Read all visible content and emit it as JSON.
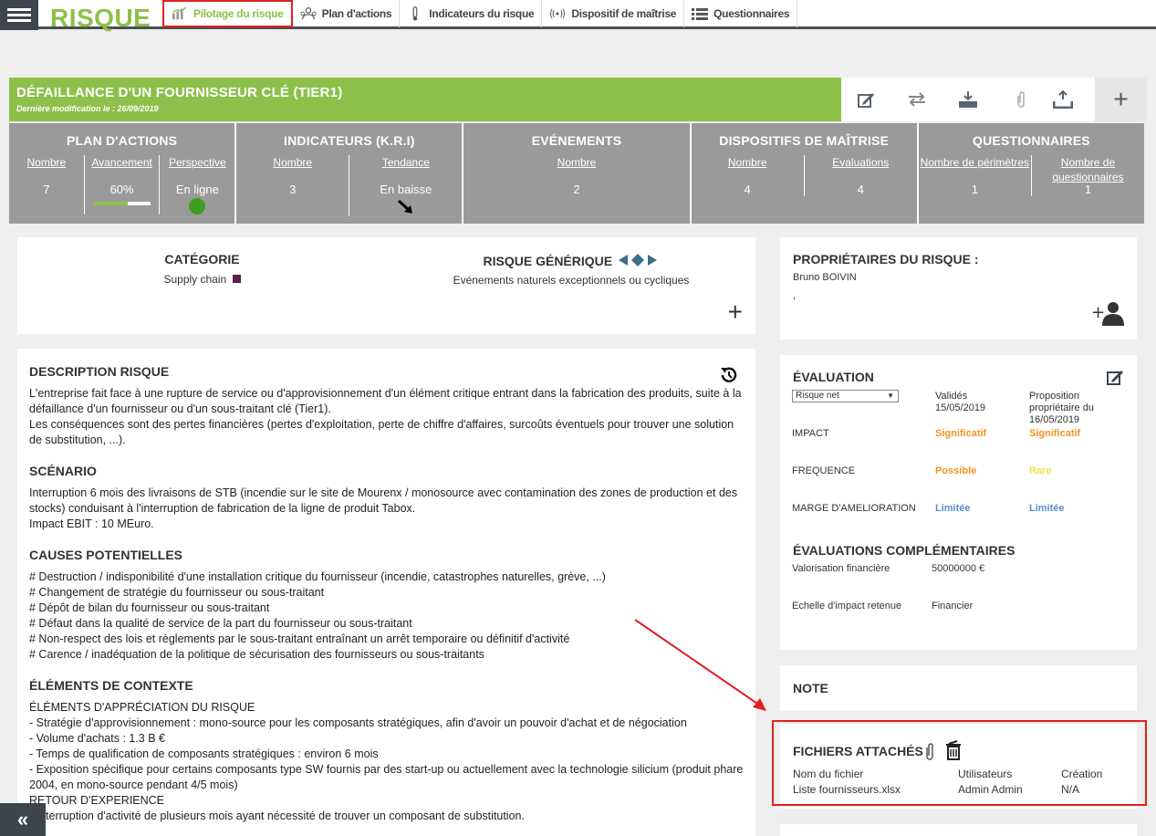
{
  "app": {
    "brand": "RISQUE"
  },
  "nav": {
    "tabs": [
      {
        "label": "Pilotage du risque",
        "icon": "bar-chart-icon"
      },
      {
        "label": "Plan d'actions",
        "icon": "people-plan-icon"
      },
      {
        "label": "Indicateurs du risque",
        "icon": "thermometer-icon"
      },
      {
        "label": "Dispositif de maîtrise",
        "icon": "broadcast-icon"
      },
      {
        "label": "Questionnaires",
        "icon": "list-icon"
      }
    ]
  },
  "header": {
    "title": "DÉFAILLANCE D'UN FOURNISSEUR CLÉ (TIER1)",
    "last_modified": "Dernière modification le : 26/09/2019"
  },
  "stats": {
    "plan": {
      "title": "PLAN D'ACTIONS",
      "nombre_lbl": "Nombre",
      "nombre": "7",
      "avancement_lbl": "Avancement",
      "avancement": "60%",
      "progress": 0.6,
      "perspective_lbl": "Perspective",
      "perspective": "En ligne",
      "perspective_color": "#3f9c1f"
    },
    "kri": {
      "title": "INDICATEURS (K.R.I)",
      "nombre_lbl": "Nombre",
      "nombre": "3",
      "tendance_lbl": "Tendance",
      "tendance": "En baisse"
    },
    "events": {
      "title": "EVÉNEMENTS",
      "nombre_lbl": "Nombre",
      "nombre": "2"
    },
    "dispositifs": {
      "title": "DISPOSITIFS DE MAÎTRISE",
      "nombre_lbl": "Nombre",
      "nombre": "4",
      "evaluations_lbl": "Evaluations",
      "evaluations": "4"
    },
    "questionnaires": {
      "title": "QUESTIONNAIRES",
      "perimetres_lbl": "Nombre de périmètres",
      "perimetres": "1",
      "questionnaires_lbl": "Nombre de questionnaires",
      "questionnaires": "1"
    }
  },
  "categorie": {
    "title": "CATÉGORIE",
    "value": "Supply chain",
    "swatch_color": "#5a1f4a"
  },
  "generique": {
    "title": "RISQUE GÉNÉRIQUE",
    "value": "Evénements naturels exceptionnels ou cycliques"
  },
  "proprietaires": {
    "title": "PROPRIÉTAIRES DU RISQUE :",
    "name": "Bruno BOIVIN",
    "extra": ","
  },
  "description": {
    "sections": [
      {
        "title": "DESCRIPTION RISQUE",
        "lines": [
          "L'entreprise fait face à une rupture de service ou d'approvisionnement d'un élément critique entrant dans la fabrication des produits, suite à la défaillance d'un fournisseur ou d'un sous-traitant clé (Tier1).",
          "Les conséquences sont des pertes financières (pertes d'exploitation, perte de chiffre d'affaires, surcoûts éventuels pour trouver une solution de substitution, ...)."
        ]
      },
      {
        "title": "SCÉNARIO",
        "lines": [
          "Interruption 6 mois des livraisons de STB (incendie sur le site de Mourenx / monosource avec contamination des zones de production et des stocks) conduisant à l'interruption de fabrication de la ligne de produit Tabox.",
          "Impact EBIT : 10 MEuro."
        ]
      },
      {
        "title": "CAUSES POTENTIELLES",
        "lines": [
          "# Destruction / indisponibilité d'une installation critique du fournisseur (incendie, catastrophes naturelles, grève, ...)",
          "# Changement de stratégie du fournisseur ou sous-traitant",
          "# Dépôt de bilan du fournisseur ou sous-traitant",
          "# Défaut dans la qualité de service de la part du fournisseur ou sous-traitant",
          "# Non-respect des lois et règlements par le sous-traitant entraînant un arrêt temporaire ou définitif d'activité",
          "# Carence / inadéquation de la politique de sécurisation des fournisseurs ou sous-traitants"
        ]
      },
      {
        "title": "ÉLÉMENTS DE CONTEXTE",
        "lines": [
          "ÉLÉMENTS D'APPRÉCIATION DU RISQUE",
          "- Stratégie d'approvisionnement : mono-source pour les composants stratégiques, afin d'avoir un pouvoir d'achat et de négociation",
          "- Volume d'achats : 1.3 B €",
          "- Temps de qualification de composants stratégiques : environ 6 mois",
          "- Exposition spécifique pour certains composants type SW fournis par des start-up ou actuellement avec la technologie silicium (produit phare 2004, en mono-source pendant 4/5 mois)",
          "RETOUR D'EXPERIENCE",
          "- Interruption d'activité de plusieurs mois ayant nécessité de trouver un composant de substitution."
        ]
      }
    ]
  },
  "evaluation": {
    "title": "ÉVALUATION",
    "select": "Risque net",
    "col1_header": "Validés 15/05/2019",
    "col2_header": "Proposition propriétaire du 16/05/2019",
    "rows": [
      {
        "label": "IMPACT",
        "v1": "Significatif",
        "v1_color": "#f29325",
        "v2": "Significatif",
        "v2_color": "#f29325"
      },
      {
        "label": "FREQUENCE",
        "v1": "Possible",
        "v1_color": "#f29325",
        "v2": "Rare",
        "v2_color": "#f2e24a"
      },
      {
        "label": "MARGE D'AMELIORATION",
        "v1": "Limitée",
        "v1_color": "#5a8fc7",
        "v2": "Limitée",
        "v2_color": "#5a8fc7"
      }
    ],
    "comp_title": "ÉVALUATIONS COMPLÉMENTAIRES",
    "comp": [
      {
        "label": "Valorisation financière",
        "value": "50000000 €"
      },
      {
        "label": "Echelle d'impact retenue",
        "value": "Financier"
      }
    ]
  },
  "note": {
    "title": "NOTE"
  },
  "fichiers": {
    "title": "FICHIERS ATTACHÉS",
    "headers": [
      "Nom du fichier",
      "Utilisateurs",
      "Création"
    ],
    "rows": [
      [
        "Liste fournisseurs.xlsx",
        "Admin Admin",
        "N/A"
      ]
    ]
  },
  "sidebar_toggle": "«"
}
